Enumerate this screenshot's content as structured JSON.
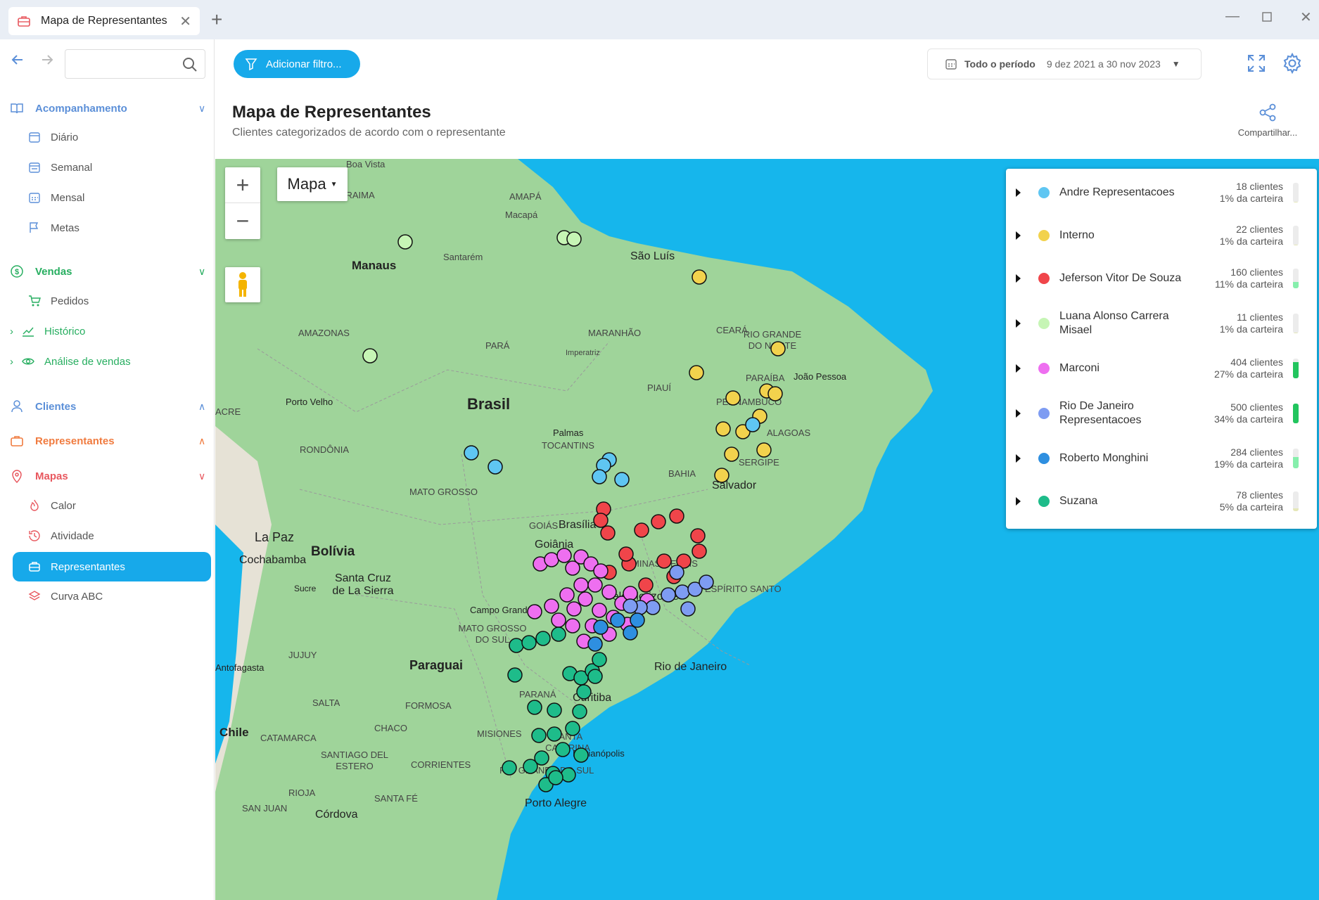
{
  "window": {
    "tab_title": "Mapa de Representantes"
  },
  "sidebar": {
    "sections": [
      {
        "label": "Acompanhamento",
        "color": "#5b8fd8",
        "items": [
          "Diário",
          "Semanal",
          "Mensal",
          "Metas"
        ]
      },
      {
        "label": "Vendas",
        "color": "#27ae60",
        "items": [
          "Pedidos",
          "Histórico",
          "Análise de vendas"
        ]
      },
      {
        "label": "Clientes",
        "color": "#5b8fd8"
      },
      {
        "label": "Representantes",
        "color": "#f07b3f"
      },
      {
        "label": "Mapas",
        "color": "#e8585f",
        "items": [
          "Calor",
          "Atividade",
          "Representantes",
          "Curva ABC"
        ]
      }
    ],
    "active_item": "Representantes"
  },
  "toolbar": {
    "filter_label": "Adicionar filtro...",
    "period_label": "Todo o período",
    "period_range": "9 dez 2021 a 30 nov 2023"
  },
  "page": {
    "title": "Mapa de Representantes",
    "subtitle": "Clientes categorizados de acordo com o representante",
    "share_label": "Compartilhar..."
  },
  "map": {
    "map_type_label": "Mapa",
    "labels": [
      "Boa Vista",
      "RORAIMA",
      "AMAPÁ",
      "Macapá",
      "Manaus",
      "Santarém",
      "São Luís",
      "AMAZONAS",
      "PARÁ",
      "MARANHÃO",
      "CEARÁ",
      "RIO GRANDE DO NORTE",
      "João Pessoa",
      "PARAÍBA",
      "Imperatriz",
      "PIAUÍ",
      "PERNAMBUCO",
      "ALAGOAS",
      "Brasil",
      "Porto Velho",
      "ACRE",
      "Palmas",
      "TOCANTINS",
      "SERGIPE",
      "RONDÔNIA",
      "BAHIA",
      "Salvador",
      "MATO GROSSO",
      "GOIÁS",
      "Brasília",
      "Goiânia",
      "La Paz",
      "Bolívia",
      "Cochabamba",
      "Santa Cruz de La Sierra",
      "Sucre",
      "MINAS GERAIS",
      "Belo Horizonte",
      "ESPÍRITO SANTO",
      "Campo Grande",
      "MATO GROSSO DO SUL",
      "Rio de Janeiro",
      "JUJUY",
      "Paraguai",
      "Antofagasta",
      "PARANÁ",
      "Curitiba",
      "SALTA",
      "FORMOSA",
      "CHACO",
      "Chile",
      "CATAMARCA",
      "MISIONES",
      "SANTA CATARINA",
      "Florianópolis",
      "SANTIAGO DEL ESTERO",
      "CORRIENTES",
      "RIO GRANDE DO SUL",
      "RIOJA",
      "SANTA FÉ",
      "SAN JUAN",
      "Córdova",
      "Porto Alegre"
    ]
  },
  "legend": [
    {
      "name": "Andre Representacoes",
      "clientes": "18 clientes",
      "carteira": "1% da carteira",
      "share": 0.01,
      "color": "#5fc6f2"
    },
    {
      "name": "Interno",
      "clientes": "22 clientes",
      "carteira": "1% da carteira",
      "share": 0.01,
      "color": "#f2d24d"
    },
    {
      "name": "Jeferson Vitor De Souza",
      "clientes": "160 clientes",
      "carteira": "11% da carteira",
      "share": 0.11,
      "color": "#f0454a"
    },
    {
      "name": "Luana Alonso Carrera Misael",
      "clientes": "11 clientes",
      "carteira": "1% da carteira",
      "share": 0.01,
      "color": "#c6f5b5"
    },
    {
      "name": "Marconi",
      "clientes": "404 clientes",
      "carteira": "27% da carteira",
      "share": 0.27,
      "color": "#ee6ff0"
    },
    {
      "name": "Rio De Janeiro Representacoes",
      "clientes": "500 clientes",
      "carteira": "34% da carteira",
      "share": 0.34,
      "color": "#7e9cf2"
    },
    {
      "name": "Roberto Monghini",
      "clientes": "284 clientes",
      "carteira": "19% da carteira",
      "share": 0.19,
      "color": "#2e8fe0"
    },
    {
      "name": "Suzana",
      "clientes": "78 clientes",
      "carteira": "5% da carteira",
      "share": 0.05,
      "color": "#1ebc8a"
    }
  ]
}
